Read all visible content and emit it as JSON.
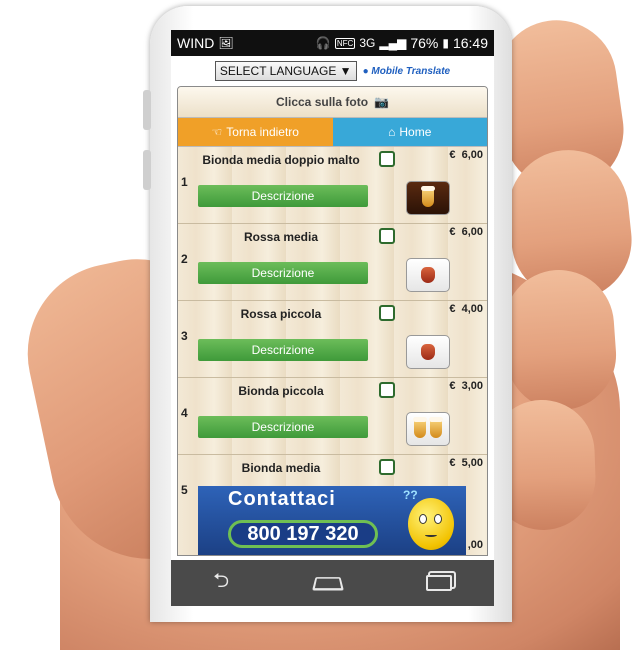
{
  "status_bar": {
    "carrier": "WIND",
    "network": "3G",
    "battery": "76%",
    "time": "16:49"
  },
  "translate": {
    "select_label": "SELECT LANGUAGE ▼",
    "brand": "Mobile Translate"
  },
  "app": {
    "photo_hint": "Clicca sulla foto",
    "back_label": "Torna indietro",
    "home_label": "Home",
    "description_label": "Descrizione",
    "currency": "€",
    "items": [
      {
        "number": "1",
        "name": "Bionda media doppio malto",
        "price": "6,00",
        "image": "beer-pint-icon"
      },
      {
        "number": "2",
        "name": "Rossa media",
        "price": "6,00",
        "image": "red-beer-glass-icon"
      },
      {
        "number": "3",
        "name": "Rossa piccola",
        "price": "4,00",
        "image": "red-beer-glass-icon"
      },
      {
        "number": "4",
        "name": "Bionda piccola",
        "price": "3,00",
        "image": "two-beer-mugs-icon"
      },
      {
        "number": "5",
        "name": "Bionda media",
        "price": "5,00",
        "image": "beer-icon"
      }
    ],
    "trailing_price": ",00"
  },
  "banner": {
    "title": "Contattaci",
    "phone": "800 197 320",
    "question_marks": "??"
  }
}
